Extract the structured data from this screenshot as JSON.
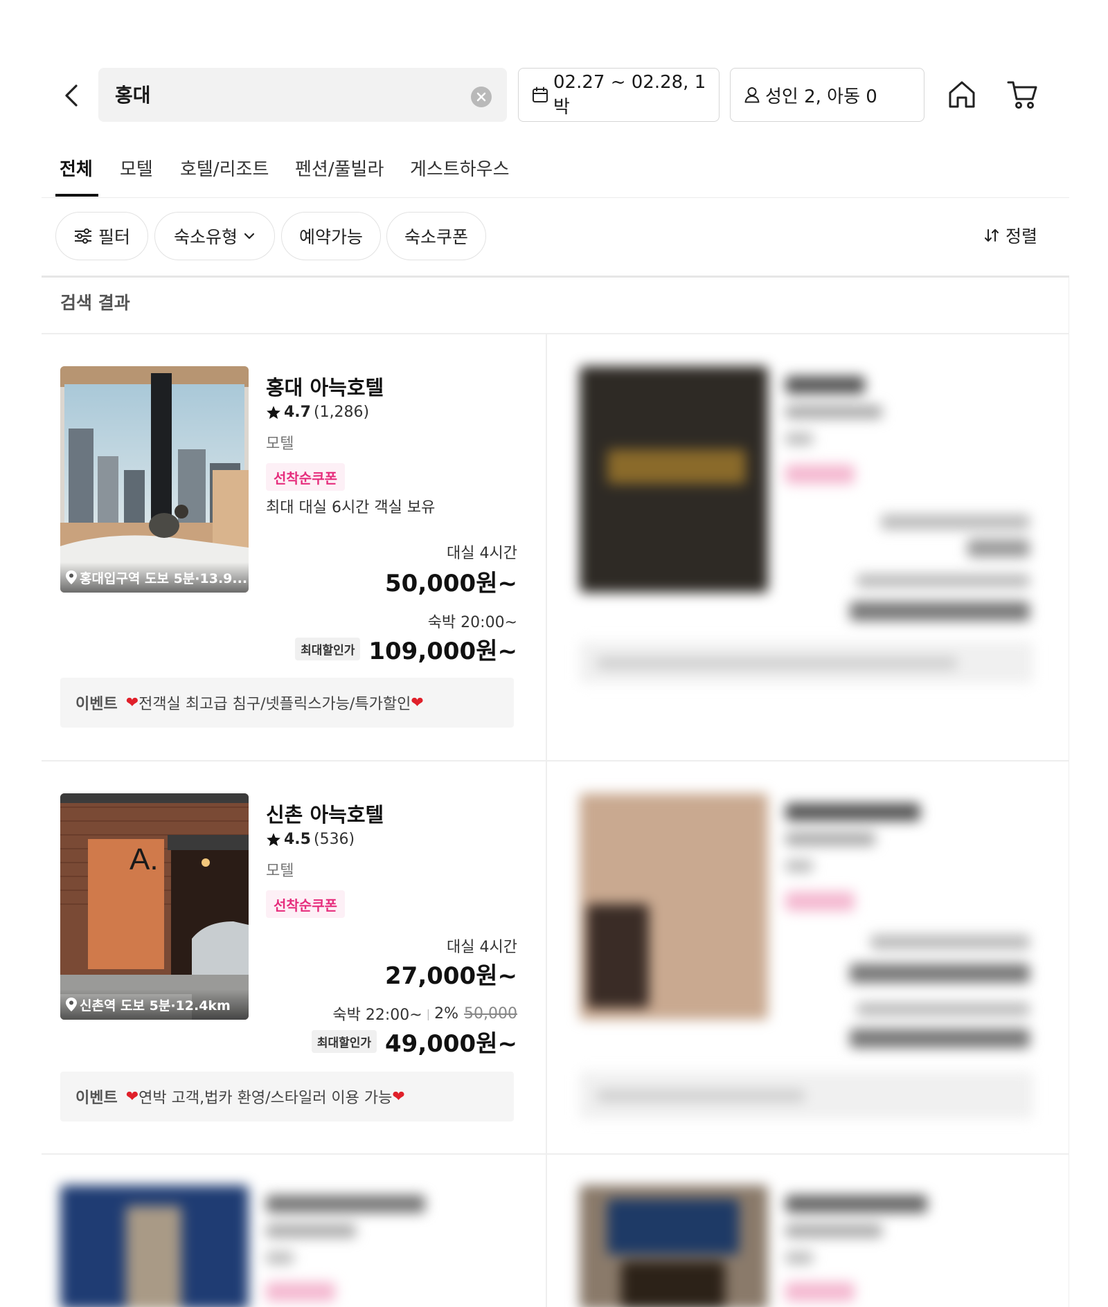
{
  "header": {
    "search_query": "홍대",
    "date_range": "02.27 ~ 02.28, 1박",
    "guests": "성인 2, 아동 0"
  },
  "tabs": [
    "전체",
    "모텔",
    "호텔/리조트",
    "펜션/풀빌라",
    "게스트하우스"
  ],
  "filters": {
    "filter_label": "필터",
    "type_label": "숙소유형",
    "available_label": "예약가능",
    "coupon_label": "숙소쿠폰",
    "sort_label": "정렬"
  },
  "results": {
    "title": "검색 결과",
    "items": [
      {
        "name": "홍대 아늑호텔",
        "rating": "4.7",
        "reviews": "(1,286)",
        "type": "모텔",
        "coupon": "선착순쿠폰",
        "description": "최대 대실 6시간 객실 보유",
        "location": "홍대입구역 도보 5분·13.9...",
        "rental_label": "대실 4시간",
        "rental_price": "50,000원~",
        "stay_label": "숙박 20:00~",
        "stay_badge": "최대할인가",
        "stay_price": "109,000원~",
        "event_label": "이벤트",
        "event_text": "전객실 최고급 침구/넷플릭스가능/특가할인"
      },
      {
        "name": "신촌 아늑호텔",
        "rating": "4.5",
        "reviews": "(536)",
        "type": "모텔",
        "coupon": "선착순쿠폰",
        "location": "신촌역 도보 5분·12.4km",
        "rental_label": "대실 4시간",
        "rental_price": "27,000원~",
        "stay_label": "숙박 22:00~",
        "stay_discount": "2%",
        "stay_original": "50,000",
        "stay_badge": "최대할인가",
        "stay_price": "49,000원~",
        "event_label": "이벤트",
        "event_text": "연박 고객,법카 환영/스타일러 이용 가능"
      }
    ]
  },
  "colors": {
    "accent_pink": "#e62e7d",
    "heart_red": "#e0202a"
  }
}
